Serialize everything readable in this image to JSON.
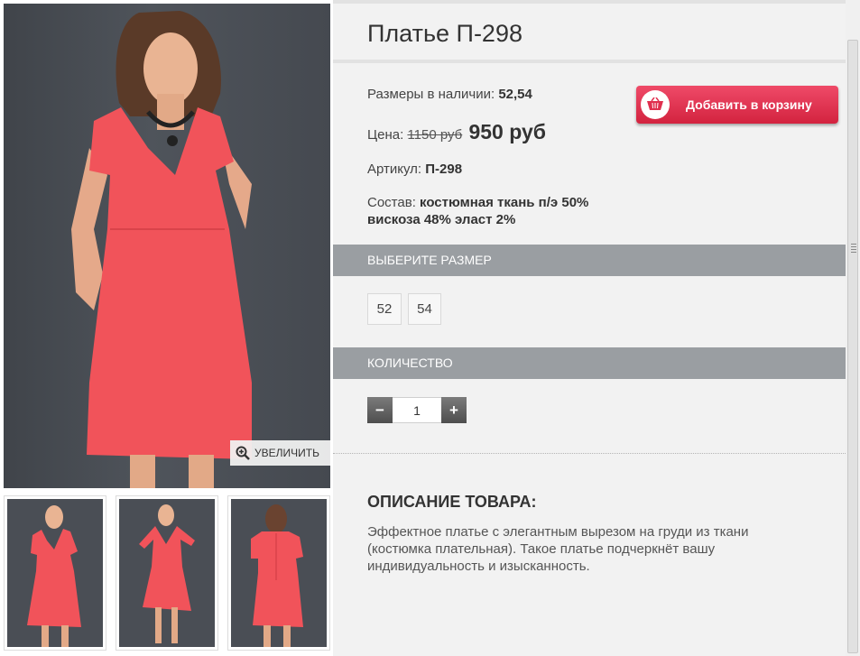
{
  "product": {
    "title": "Платье П-298",
    "sizes_label": "Размеры в наличии:",
    "sizes_value": "52,54",
    "price_label": "Цена:",
    "price_old": "1150 руб",
    "price_new": "950 руб",
    "article_label": "Артикул:",
    "article_value": "П-298",
    "composition_label": "Состав:",
    "composition_line1": "костюмная ткань п/э 50%",
    "composition_line2": "вискоза 48% эласт 2%"
  },
  "cart_button": {
    "label": "Добавить в корзину",
    "icon": "basket-icon",
    "color": "#e0304f"
  },
  "gallery": {
    "zoom_label": "УВЕЛИЧИТЬ",
    "zoom_icon": "magnifier-plus-icon",
    "dress_color": "#f1535a",
    "background_color": "#494d53"
  },
  "size_section": {
    "header": "ВЫБЕРИТЕ РАЗМЕР",
    "options": [
      "52",
      "54"
    ]
  },
  "quantity_section": {
    "header": "КОЛИЧЕСТВО",
    "minus": "−",
    "plus": "+",
    "value": "1"
  },
  "description": {
    "title": "ОПИСАНИЕ ТОВАРА:",
    "text": "Эффектное платье с элегантным вырезом на груди из ткани (костюмка плательная). Такое платье подчеркнёт вашу индивидуальность и изысканность."
  }
}
